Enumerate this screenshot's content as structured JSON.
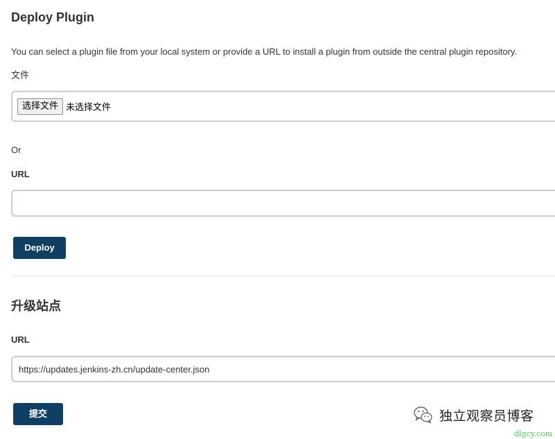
{
  "deploy": {
    "title": "Deploy Plugin",
    "description": "You can select a plugin file from your local system or provide a URL to install a plugin from outside the central plugin repository.",
    "file_label": "文件",
    "file_button_label": "选择文件",
    "file_status": "未选择文件",
    "or_label": "Or",
    "url_label": "URL",
    "url_value": "",
    "deploy_button_label": "Deploy"
  },
  "update_site": {
    "title": "升级站点",
    "url_label": "URL",
    "url_value": "https://updates.jenkins-zh.cn/update-center.json",
    "submit_button_label": "提交"
  },
  "watermark": {
    "icon": "wechat-icon",
    "text": "独立观察员博客",
    "domain": "dlgcy.com"
  },
  "colors": {
    "primary_button": "#0f3f62",
    "input_border": "#c9ced0",
    "watermark_domain": "#47d14f"
  }
}
